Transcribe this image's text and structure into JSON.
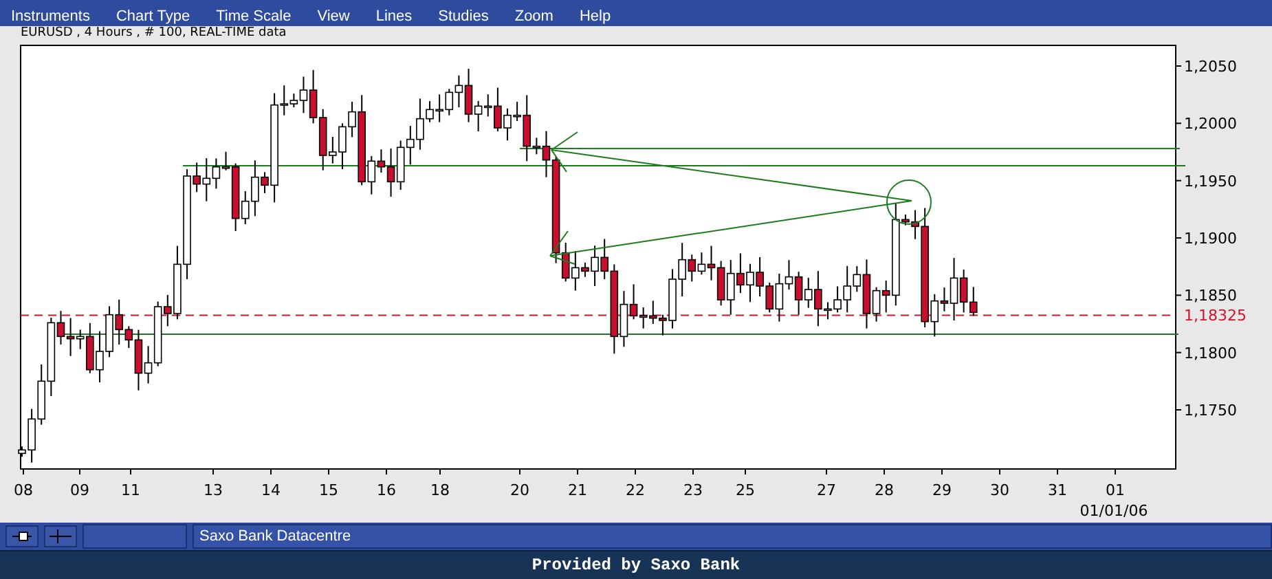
{
  "menu": [
    "Instruments",
    "Chart Type",
    "Time Scale",
    "View",
    "Lines",
    "Studies",
    "Zoom",
    "Help"
  ],
  "chart": {
    "title": "EURUSD , 4 Hours , # 100, REAL-TIME data",
    "y_axis_labels": [
      "1,2050",
      "1,2000",
      "1,1950",
      "1,1900",
      "1,1850",
      "1,1800",
      "1,1750"
    ],
    "price_marker": "1,18325",
    "x_axis_labels": [
      "08",
      "09",
      "11",
      "13",
      "14",
      "15",
      "16",
      "18",
      "20",
      "21",
      "22",
      "23",
      "25",
      "27",
      "28",
      "29",
      "30",
      "31",
      "01"
    ],
    "date_label": "01/01/06"
  },
  "toolbar": {
    "status": "Saxo Bank Datacentre"
  },
  "footer": "Provided by Saxo Bank"
}
